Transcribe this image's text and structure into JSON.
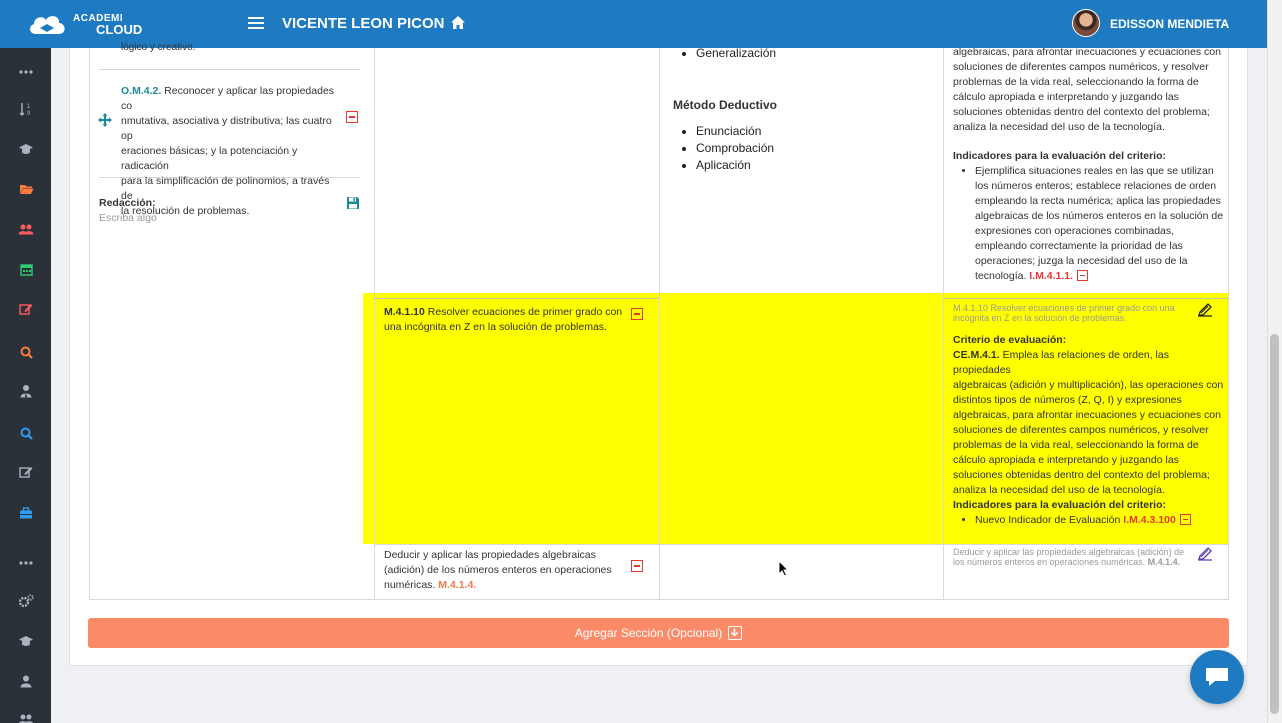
{
  "topbar": {
    "brand_top": "ACADEMI",
    "brand_bottom": "CLOUD",
    "title": "VICENTE LEON PICON",
    "user_name": "EDISSON MENDIETA",
    "bg_color": "#1e7bc2"
  },
  "sidebar": {
    "bg_color": "#2a3139",
    "items": [
      {
        "icon": "more-dots-icon",
        "color": "#aab2bd"
      },
      {
        "icon": "sort-numeric-icon",
        "color": "#aab2bd"
      },
      {
        "icon": "graduation-cap-icon",
        "color": "#aab2bd"
      },
      {
        "icon": "folder-open-icon",
        "color": "#ff7a3d"
      },
      {
        "icon": "users-icon",
        "color": "#ff5a5f"
      },
      {
        "icon": "calendar-icon",
        "color": "#2ecc71"
      },
      {
        "icon": "edit-icon",
        "color": "#ff5a5f"
      },
      {
        "icon": "search-icon",
        "color": "#ff7a3d"
      },
      {
        "icon": "user-tie-icon",
        "color": "#aab2bd"
      },
      {
        "icon": "search-icon",
        "color": "#2e9df0"
      },
      {
        "icon": "edit-icon",
        "color": "#aab2bd"
      },
      {
        "icon": "briefcase-icon",
        "color": "#2e9df0"
      },
      {
        "icon": "more-dots-icon",
        "color": "#aab2bd"
      },
      {
        "icon": "cogs-icon",
        "color": "#aab2bd"
      },
      {
        "icon": "graduation-cap-icon",
        "color": "#aab2bd"
      },
      {
        "icon": "user-icon",
        "color": "#aab2bd"
      },
      {
        "icon": "users-icon",
        "color": "#aab2bd"
      }
    ]
  },
  "col1": {
    "top_text": "lógico y creativo.",
    "objective_code": "O.M.4.2.",
    "objective_line1": " Reconocer y aplicar las propiedades co",
    "objective_line2": "nmutativa, asociativa y distributiva; las cuatro op",
    "objective_line3": "eraciones básicas; y la potenciación y radicación",
    "objective_line4": "para la simplificación de polinomios, a través de",
    "objective_line5": "la resolución de problemas.",
    "redaccion_label": "Redacción:",
    "redaccion_placeholder": "Escriba algo"
  },
  "col3": {
    "top_item": "Generalización",
    "method_title": "Método Deductivo",
    "method_items": [
      "Enunciación",
      "Comprobación",
      "Aplicación"
    ]
  },
  "col4_top": {
    "lines": [
      "algebraicas, para afrontar inecuaciones y ecuaciones con",
      "soluciones de diferentes campos numéricos, y resolver",
      "problemas de la vida real, seleccionando la forma de",
      "cálculo apropiada e interpretando y juzgando las",
      "soluciones obtenidas dentro del contexto del problema;",
      "analiza la necesidad del uso de la tecnología."
    ],
    "indicators_title": "Indicadores para la evaluación del criterio:",
    "indicator_lines": [
      "Ejemplifica situaciones reales en las que se utilizan",
      "los números enteros; establece relaciones de orden",
      "empleando la recta numérica; aplica las propiedades",
      "algebraicas de los números enteros en la solución de",
      "expresiones con operaciones combinadas,",
      "empleando correctamente la prioridad de las",
      "operaciones; juzga la necesidad del uso de la"
    ],
    "indicator_last": "tecnología.",
    "indicator_code": "I.M.4.1.1."
  },
  "highlight_row": {
    "skill_code": "M.4.1.10",
    "skill_line1": " Resolver ecuaciones de primer grado con",
    "skill_line2": "una incógnita en Z en la solución de problemas.",
    "summary_line1": "M.4.1.10 Resolver ecuaciones de primer grado con una",
    "summary_line2": "incógnita en Z en la solución de problemas.",
    "criteria_title": "Criterio de evaluación:",
    "criteria_code": "CE.M.4.1.",
    "criteria_line1": " Emplea las relaciones de orden, las propiedades",
    "criteria_lines": [
      "algebraicas (adición y multiplicación), las operaciones con",
      "distintos tipos de números (Z, Q, I) y expresiones",
      "algebraicas, para afrontar inecuaciones y ecuaciones con",
      "soluciones de diferentes campos numéricos, y resolver",
      "problemas de la vida real, seleccionando la forma de",
      "cálculo apropiada e interpretando y juzgando las",
      "soluciones obtenidas dentro del contexto del problema;",
      "analiza la necesidad del uso de la tecnología."
    ],
    "indicators_title": "Indicadores para la evaluación del criterio:",
    "indicator_text": "Nuevo Indicador de Evaluación",
    "indicator_code": "I.M.4.3.100",
    "highlight_color": "#ffff00"
  },
  "last_row": {
    "skill_line1": "Deducir y aplicar las propiedades algebraicas",
    "skill_line2": "(adición) de los números enteros en operaciones",
    "skill_line3": "numéricas.",
    "skill_code": "M.4.1.4.",
    "summary_line1": "Deducir y aplicar las propiedades algebraicas (adición) de",
    "summary_line2": "los números enteros en operaciones numéricas.",
    "summary_code": "M.4.1.4."
  },
  "actions": {
    "add_section_label": "Agregar Sección (Opcional)",
    "add_section_color": "#fb8b68"
  }
}
